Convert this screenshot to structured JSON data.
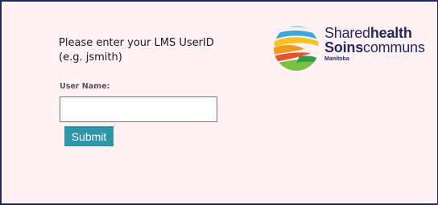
{
  "form": {
    "prompt_line1": "Please enter your LMS UserID",
    "prompt_line2": "(e.g. jsmith)",
    "username_label": "User Name:",
    "username_value": "",
    "username_placeholder": "",
    "submit_label": "Submit"
  },
  "logo": {
    "word_shared": "Shared",
    "word_health": "health",
    "word_soins": "Soins",
    "word_communs": "communs",
    "word_manitoba": "Manitoba"
  },
  "colors": {
    "page_background": "#fff1f4",
    "frame_border": "#1f2a5a",
    "submit_button": "#2e95a6",
    "brand_navy": "#1f2a5a"
  }
}
